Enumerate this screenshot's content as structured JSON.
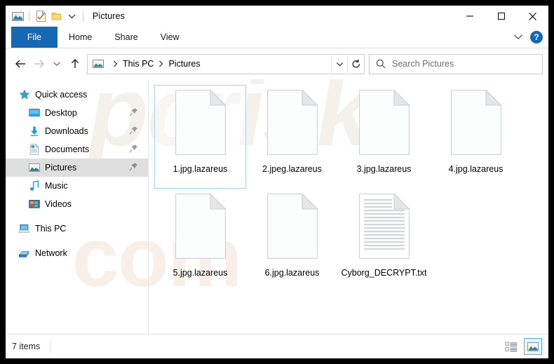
{
  "window": {
    "title": "Pictures",
    "controls": {
      "minimize": "minimize",
      "maximize": "maximize",
      "close": "close"
    }
  },
  "quick_access_toolbar": {
    "items": [
      {
        "name": "pictures-folder-icon",
        "label": "Pictures"
      },
      {
        "name": "properties-icon",
        "label": "Properties"
      },
      {
        "name": "new-folder-icon",
        "label": "New folder"
      },
      {
        "name": "customize-chevron-icon",
        "label": "Customize Quick Access Toolbar"
      }
    ]
  },
  "ribbon": {
    "file_tab": "File",
    "tabs": [
      "Home",
      "Share",
      "View"
    ],
    "expand_label": "Expand the Ribbon",
    "help_label": "?"
  },
  "addressbar": {
    "back": "Back",
    "forward": "Forward",
    "recent": "Recent locations",
    "up": "Up to This PC",
    "breadcrumbs": [
      "This PC",
      "Pictures"
    ],
    "dropdown": "Previous locations",
    "refresh": "Refresh Pictures"
  },
  "search": {
    "placeholder": "Search Pictures"
  },
  "sidebar": {
    "groups": [
      {
        "header": {
          "label": "Quick access",
          "icon": "star-icon"
        },
        "items": [
          {
            "label": "Desktop",
            "icon": "desktop-icon",
            "pinned": true,
            "selected": false
          },
          {
            "label": "Downloads",
            "icon": "downloads-icon",
            "pinned": true,
            "selected": false
          },
          {
            "label": "Documents",
            "icon": "documents-icon",
            "pinned": true,
            "selected": false
          },
          {
            "label": "Pictures",
            "icon": "pictures-icon",
            "pinned": true,
            "selected": true
          },
          {
            "label": "Music",
            "icon": "music-icon",
            "pinned": false,
            "selected": false
          },
          {
            "label": "Videos",
            "icon": "videos-icon",
            "pinned": false,
            "selected": false
          }
        ]
      },
      {
        "header": {
          "label": "This PC",
          "icon": "this-pc-icon"
        },
        "items": []
      },
      {
        "header": {
          "label": "Network",
          "icon": "network-icon"
        },
        "items": []
      }
    ]
  },
  "files": [
    {
      "name": "1.jpg.lazareus",
      "icon": "blank-file-icon",
      "selected": true
    },
    {
      "name": "2.jpeg.lazareus",
      "icon": "blank-file-icon",
      "selected": false
    },
    {
      "name": "3.jpg.lazareus",
      "icon": "blank-file-icon",
      "selected": false
    },
    {
      "name": "4.jpg.lazareus",
      "icon": "blank-file-icon",
      "selected": false
    },
    {
      "name": "5.jpg.lazareus",
      "icon": "blank-file-icon",
      "selected": false
    },
    {
      "name": "6.jpg.lazareus",
      "icon": "blank-file-icon",
      "selected": false
    },
    {
      "name": "Cyborg_DECRYPT.txt",
      "icon": "text-file-icon",
      "selected": false
    }
  ],
  "statusbar": {
    "item_count": "7 items",
    "views": [
      {
        "name": "details-view-button",
        "label": "Details view",
        "active": false
      },
      {
        "name": "large-icons-view-button",
        "label": "Large icons view",
        "active": true
      }
    ]
  },
  "watermark": {
    "line_a": "pcrisk",
    "line_b": "com"
  },
  "colors": {
    "accent": "#1568b4",
    "selection_border": "#a7d4f2",
    "sidebar_selected": "#dededf",
    "watermark": "#f4efe9"
  }
}
